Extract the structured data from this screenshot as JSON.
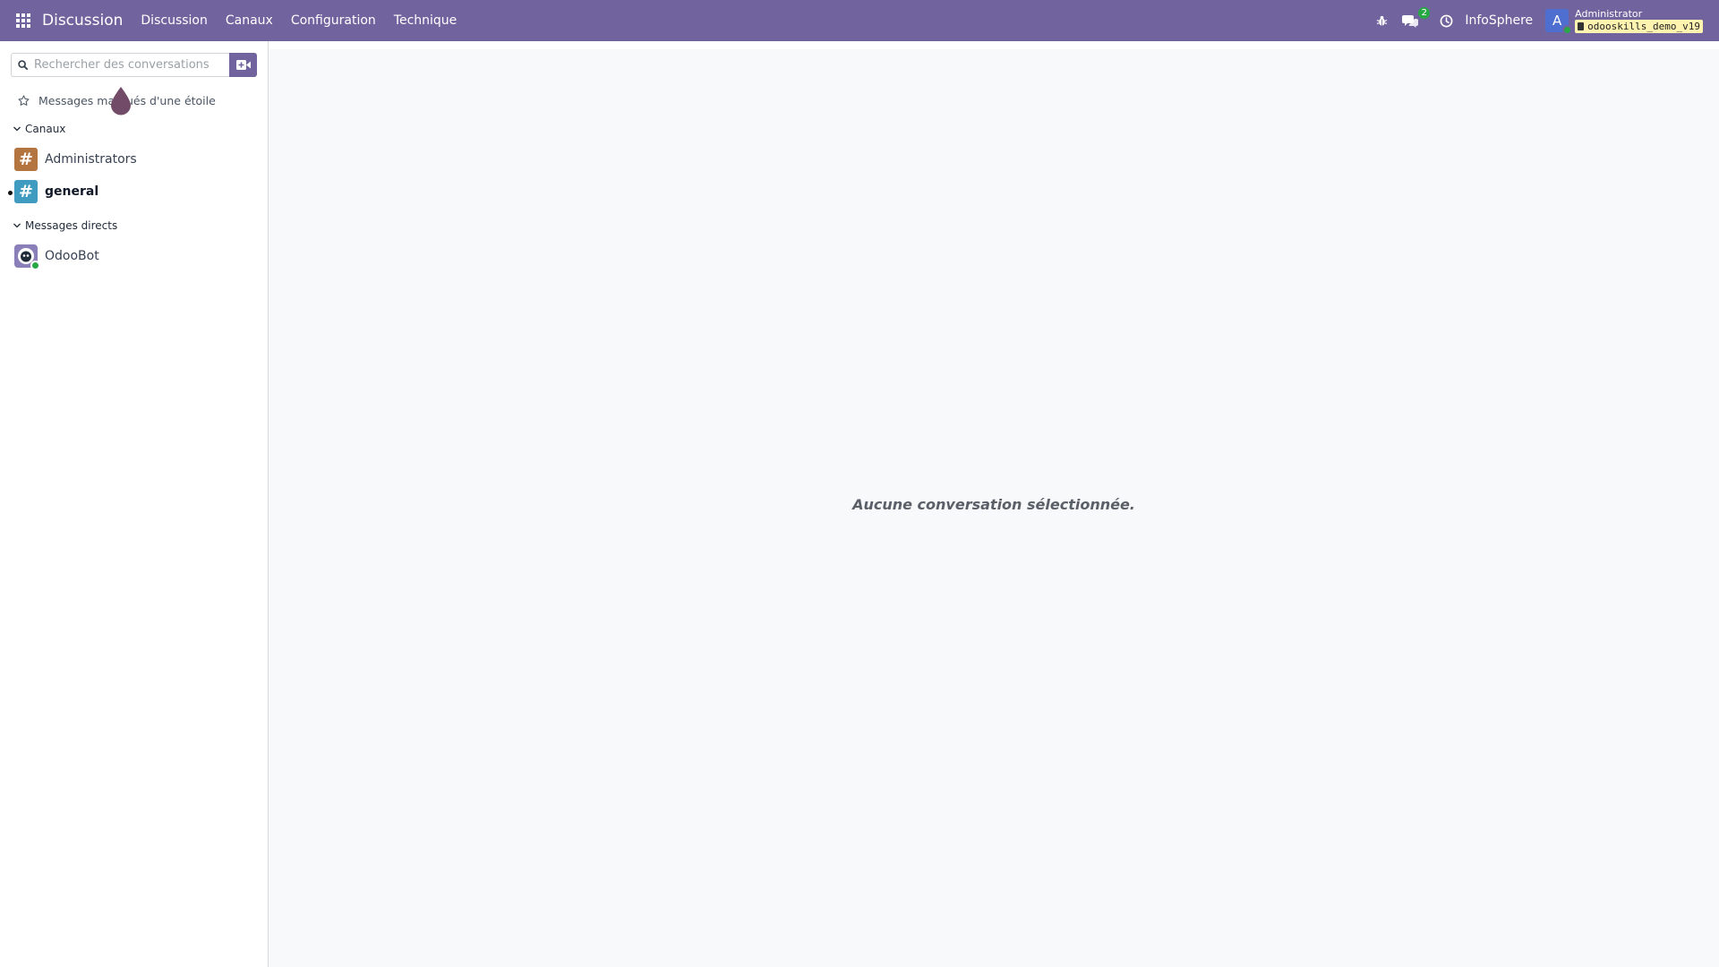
{
  "navbar": {
    "app_name": "Discussion",
    "menu": [
      "Discussion",
      "Canaux",
      "Configuration",
      "Technique"
    ],
    "message_count": "2",
    "company": "InfoSphere",
    "user_initial": "A",
    "user_name": "Administrator",
    "database": "odooskills_demo_v19",
    "color": "#71639e"
  },
  "sidebar": {
    "search_placeholder": "Rechercher des conversations",
    "starred_label": "Messages marqués d'une étoile",
    "channels_header": "Canaux",
    "channels": [
      {
        "name": "Administrators",
        "color": "#b3743f",
        "unread": false
      },
      {
        "name": "general",
        "color": "#3f9bc0",
        "unread": true
      }
    ],
    "direct_header": "Messages directs",
    "direct_messages": [
      {
        "name": "OdooBot",
        "status": "online"
      }
    ]
  },
  "main": {
    "empty_message": "Aucune conversation sélectionnée."
  }
}
